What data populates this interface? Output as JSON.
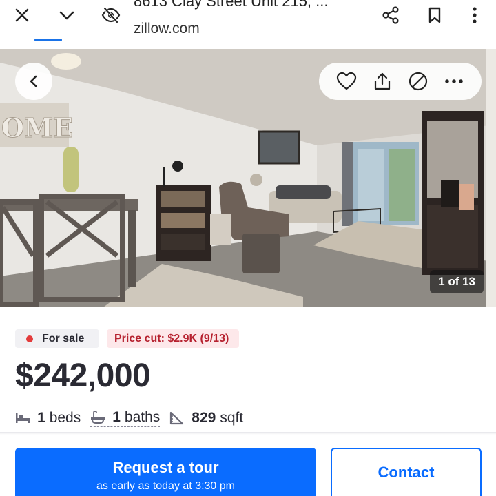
{
  "browser": {
    "page_title": "8613 Clay Street Unit 215, ...",
    "url": "zillow.com",
    "icons": [
      "close-icon",
      "chevron-down-icon",
      "eye-off-icon",
      "share-icon",
      "bookmark-icon",
      "more-vert-icon"
    ]
  },
  "gallery": {
    "counter": "1 of 13",
    "photo_text": "OME",
    "actions": [
      "heart-icon",
      "share-upload-icon",
      "hide-icon",
      "more-horiz-icon"
    ]
  },
  "listing": {
    "status": "For sale",
    "price_cut": "Price cut: $2.9K (9/13)",
    "price": "$242,000",
    "beds_value": "1",
    "beds_label": "beds",
    "baths_value": "1",
    "baths_label": "baths",
    "sqft_value": "829",
    "sqft_label": "sqft"
  },
  "cta": {
    "tour_label": "Request a tour",
    "tour_sub": "as early as today at 3:30 pm",
    "contact_label": "Contact"
  },
  "colors": {
    "accent": "#0a6cff",
    "sale_dot": "#e33b3b",
    "price_cut_text": "#b6212f"
  }
}
